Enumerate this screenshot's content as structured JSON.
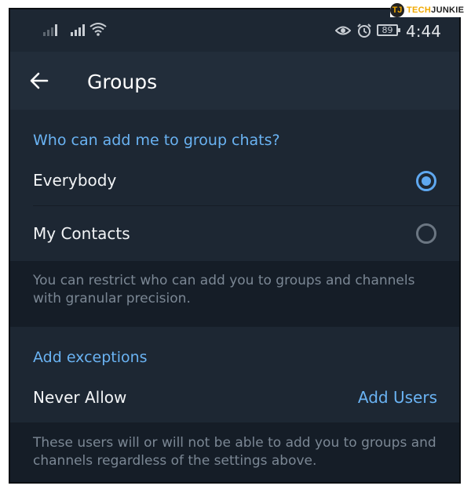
{
  "status_bar": {
    "battery": "89",
    "time": "4:44",
    "icons": [
      "signal-icon",
      "signal-icon",
      "wifi-icon",
      "eye-icon",
      "alarm-icon",
      "battery-icon"
    ]
  },
  "watermark": {
    "logo": "TJ",
    "text_a": "TECH",
    "text_b": "JUNKIE"
  },
  "app_bar": {
    "back_icon": "back-arrow-icon",
    "title": "Groups"
  },
  "who_can_add": {
    "header": "Who can add me to group chats?",
    "options": [
      {
        "label": "Everybody",
        "selected": true
      },
      {
        "label": "My Contacts",
        "selected": false
      }
    ],
    "info": "You can restrict who can add you to groups and channels with granular precision."
  },
  "exceptions": {
    "header": "Add exceptions",
    "never_allow_label": "Never Allow",
    "add_users_label": "Add Users",
    "info": "These users will or will not be able to add you to groups and channels regardless of the settings above."
  },
  "colors": {
    "accent": "#6ab3f3",
    "background": "#1d2733",
    "app_bar": "#222d3a",
    "info_background": "#151d27"
  }
}
